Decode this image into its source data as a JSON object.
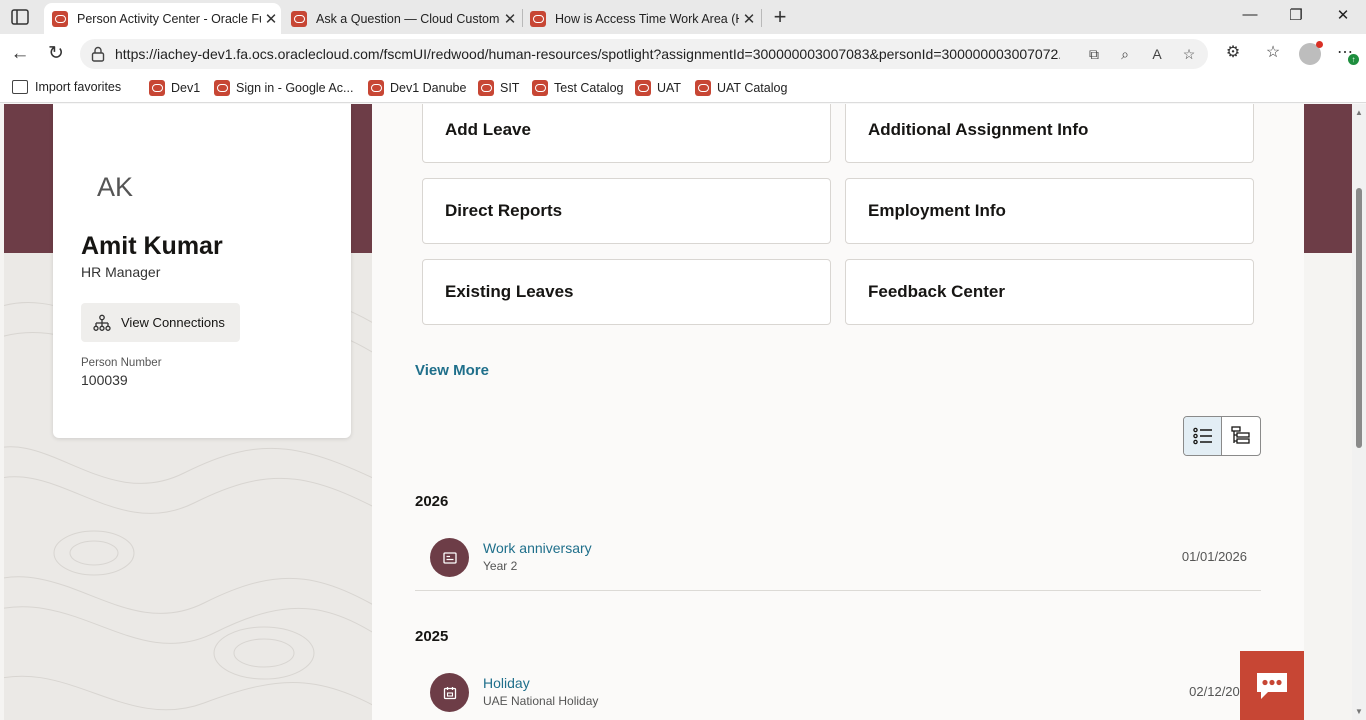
{
  "browser": {
    "tabs": [
      {
        "title": "Person Activity Center - Oracle Fu",
        "active": true
      },
      {
        "title": "Ask a Question — Cloud Custome",
        "active": false
      },
      {
        "title": "How is Access Time Work Area (H",
        "active": false
      }
    ],
    "url": "https://iachey-dev1.fa.ocs.oraclecloud.com/fscmUI/redwood/human-resources/spotlight?assignmentId=300000003007083&personId=300000003007072...",
    "favorites": [
      "Import favorites",
      "Dev1",
      "Sign in - Google Ac...",
      "Dev1 Danube",
      "SIT",
      "Test Catalog",
      "UAT",
      "UAT Catalog"
    ],
    "accent_color": "#c74634"
  },
  "profile": {
    "initials": "AK",
    "name": "Amit Kumar",
    "title": "HR Manager",
    "connections_button": "View Connections",
    "person_number_label": "Person Number",
    "person_number": "100039",
    "brand_color": "#6d3d47"
  },
  "actions": {
    "tiles": [
      "Add Leave",
      "Additional Assignment Info",
      "Direct Reports",
      "Employment Info",
      "Existing Leaves",
      "Feedback Center"
    ],
    "view_more": "View More"
  },
  "timeline": {
    "groups": [
      {
        "year": "2026",
        "events": [
          {
            "title": "Work anniversary",
            "subtitle": "Year 2",
            "date": "01/01/2026",
            "icon": "id-card-icon"
          }
        ]
      },
      {
        "year": "2025",
        "events": [
          {
            "title": "Holiday",
            "subtitle": "UAE National Holiday",
            "date": "02/12/202",
            "icon": "calendar-icon"
          }
        ]
      }
    ]
  }
}
